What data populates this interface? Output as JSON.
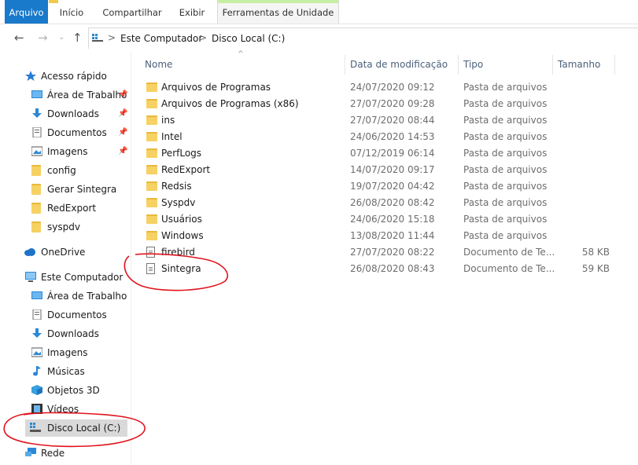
{
  "ribbon": {
    "tabs": [
      {
        "label": "Arquivo"
      },
      {
        "label": "Início"
      },
      {
        "label": "Compartilhar"
      },
      {
        "label": "Exibir"
      },
      {
        "label": "Ferramentas de Unidade"
      }
    ]
  },
  "address": {
    "crumbs": [
      "Este Computador",
      "Disco Local (C:)"
    ],
    "separator": ">"
  },
  "sidebar": {
    "quick_access": "Acesso rápido",
    "quick_items": [
      {
        "label": "Área de Trabalho",
        "icon": "desktop-icon",
        "pinned": true
      },
      {
        "label": "Downloads",
        "icon": "download-icon",
        "pinned": true
      },
      {
        "label": "Documentos",
        "icon": "documents-icon",
        "pinned": true
      },
      {
        "label": "Imagens",
        "icon": "pictures-icon",
        "pinned": true
      },
      {
        "label": "config",
        "icon": "folder-icon"
      },
      {
        "label": "Gerar Sintegra",
        "icon": "folder-icon"
      },
      {
        "label": "RedExport",
        "icon": "folder-icon"
      },
      {
        "label": "syspdv",
        "icon": "folder-icon"
      }
    ],
    "onedrive": "OneDrive",
    "this_pc": "Este Computador",
    "pc_items": [
      {
        "label": "Área de Trabalho",
        "icon": "desktop-icon"
      },
      {
        "label": "Documentos",
        "icon": "documents-icon"
      },
      {
        "label": "Downloads",
        "icon": "download-icon"
      },
      {
        "label": "Imagens",
        "icon": "pictures-icon"
      },
      {
        "label": "Músicas",
        "icon": "music-icon"
      },
      {
        "label": "Objetos 3D",
        "icon": "3d-objects-icon"
      },
      {
        "label": "Vídeos",
        "icon": "video-icon"
      },
      {
        "label": "Disco Local (C:)",
        "icon": "drive-icon",
        "selected": true
      }
    ],
    "network": "Rede"
  },
  "columns": {
    "name": "Nome",
    "date": "Data de modificação",
    "type": "Tipo",
    "size": "Tamanho"
  },
  "files": [
    {
      "name": "Arquivos de Programas",
      "date": "24/07/2020 09:12",
      "type": "Pasta de arquivos",
      "size": "",
      "icon": "folder-icon"
    },
    {
      "name": "Arquivos de Programas (x86)",
      "date": "27/07/2020 09:28",
      "type": "Pasta de arquivos",
      "size": "",
      "icon": "folder-icon"
    },
    {
      "name": "ins",
      "date": "27/07/2020 08:44",
      "type": "Pasta de arquivos",
      "size": "",
      "icon": "folder-icon"
    },
    {
      "name": "Intel",
      "date": "24/06/2020 14:53",
      "type": "Pasta de arquivos",
      "size": "",
      "icon": "folder-icon"
    },
    {
      "name": "PerfLogs",
      "date": "07/12/2019 06:14",
      "type": "Pasta de arquivos",
      "size": "",
      "icon": "folder-icon"
    },
    {
      "name": "RedExport",
      "date": "14/07/2020 09:17",
      "type": "Pasta de arquivos",
      "size": "",
      "icon": "folder-icon"
    },
    {
      "name": "Redsis",
      "date": "19/07/2020 04:42",
      "type": "Pasta de arquivos",
      "size": "",
      "icon": "folder-icon"
    },
    {
      "name": "Syspdv",
      "date": "26/08/2020 08:42",
      "type": "Pasta de arquivos",
      "size": "",
      "icon": "folder-icon"
    },
    {
      "name": "Usuários",
      "date": "24/06/2020 15:18",
      "type": "Pasta de arquivos",
      "size": "",
      "icon": "folder-icon"
    },
    {
      "name": "Windows",
      "date": "13/08/2020 11:44",
      "type": "Pasta de arquivos",
      "size": "",
      "icon": "folder-icon"
    },
    {
      "name": "firebird",
      "date": "27/07/2020 08:22",
      "type": "Documento de Te...",
      "size": "58 KB",
      "icon": "text-document-icon"
    },
    {
      "name": "Sintegra",
      "date": "26/08/2020 08:43",
      "type": "Documento de Te...",
      "size": "59 KB",
      "icon": "text-document-icon"
    }
  ],
  "colors": {
    "accent": "#1979ca",
    "annotation": "#e0141e",
    "folder": "#f6d163",
    "selected": "#d9d9d9"
  }
}
